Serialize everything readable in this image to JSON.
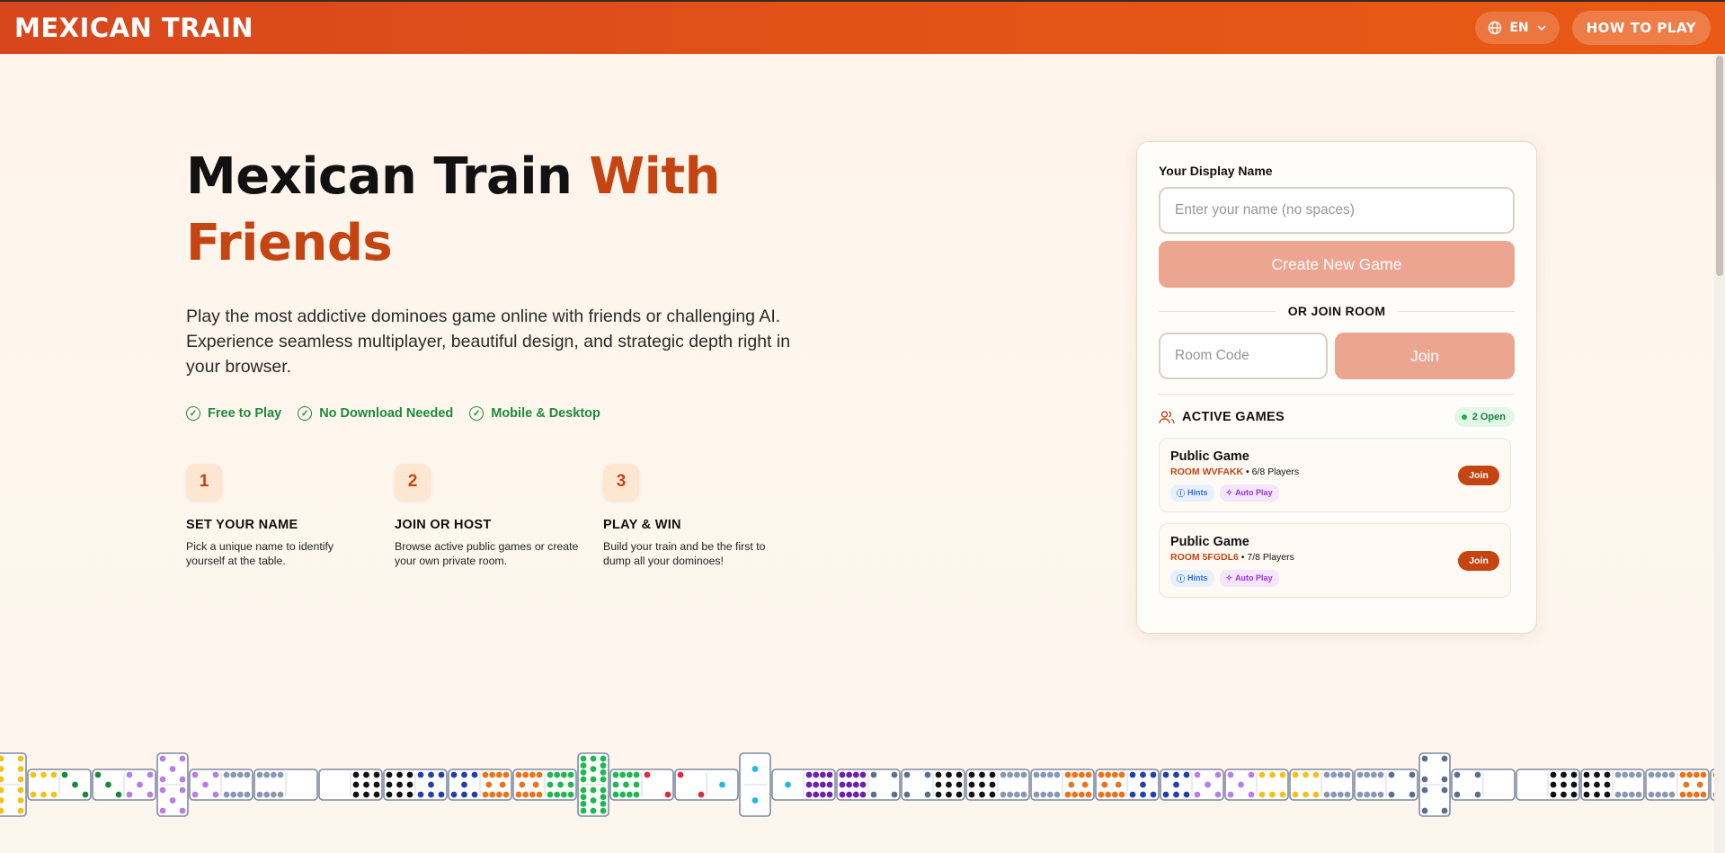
{
  "header": {
    "brand": "MEXICAN TRAIN",
    "language": "EN",
    "how_to_play": "HOW TO PLAY"
  },
  "hero": {
    "title_main": "Mexican Train ",
    "title_accent_1": "With",
    "title_accent_2": "Friends",
    "lead": "Play the most addictive dominoes game online with friends or challenging AI. Experience seamless multiplayer, beautiful design, and strategic depth right in your browser.",
    "features": [
      "Free to Play",
      "No Download Needed",
      "Mobile & Desktop"
    ]
  },
  "steps": [
    {
      "num": "1",
      "title": "SET YOUR NAME",
      "desc": "Pick a unique name to identify yourself at the table."
    },
    {
      "num": "2",
      "title": "JOIN OR HOST",
      "desc": "Browse active public games or create your own private room."
    },
    {
      "num": "3",
      "title": "PLAY & WIN",
      "desc": "Build your train and be the first to dump all your dominoes!"
    }
  ],
  "panel": {
    "name_label": "Your Display Name",
    "name_placeholder": "Enter your name (no spaces)",
    "create_button": "Create New Game",
    "or_join": "OR JOIN ROOM",
    "room_placeholder": "Room Code",
    "join_button": "Join",
    "active_games_title": "ACTIVE GAMES",
    "open_count": "2 Open",
    "games": [
      {
        "title": "Public Game",
        "room": "ROOM WVFAKK",
        "players": "• 6/8 Players",
        "hints": "Hints",
        "auto": "Auto Play",
        "join": "Join"
      },
      {
        "title": "Public Game",
        "room": "ROOM 5FGDL6",
        "players": "• 7/8 Players",
        "hints": "Hints",
        "auto": "Auto Play",
        "join": "Join"
      }
    ]
  },
  "colors": {
    "brand_orange": "#e25218",
    "accent": "#c44512",
    "feature_green": "#1c8a3a",
    "disabled_button": "#eca591"
  },
  "dominoes": [
    {
      "a": 6,
      "b": 6,
      "double": true
    },
    {
      "a": 6,
      "b": 3
    },
    {
      "a": 3,
      "b": 5
    },
    {
      "a": 5,
      "b": 5,
      "double": true
    },
    {
      "a": 5,
      "b": 8
    },
    {
      "a": 8,
      "b": 0
    },
    {
      "a": 0,
      "b": 9
    },
    {
      "a": 9,
      "b": 7
    },
    {
      "a": 7,
      "b": 10
    },
    {
      "a": 10,
      "b": 11
    },
    {
      "a": 11,
      "b": 11,
      "double": true
    },
    {
      "a": 11,
      "b": 2
    },
    {
      "a": 2,
      "b": 1
    },
    {
      "a": 1,
      "b": 1,
      "double": true
    },
    {
      "a": 1,
      "b": 12
    },
    {
      "a": 12,
      "b": 4
    },
    {
      "a": 4,
      "b": 9
    },
    {
      "a": 9,
      "b": 8
    },
    {
      "a": 8,
      "b": 10
    },
    {
      "a": 10,
      "b": 7
    },
    {
      "a": 7,
      "b": 5
    },
    {
      "a": 5,
      "b": 6
    },
    {
      "a": 6,
      "b": 8
    },
    {
      "a": 8,
      "b": 4
    },
    {
      "a": 4,
      "b": 4,
      "double": true
    },
    {
      "a": 4,
      "b": 0
    },
    {
      "a": 0,
      "b": 9
    },
    {
      "a": 9,
      "b": 8
    },
    {
      "a": 8,
      "b": 10
    },
    {
      "a": 10,
      "b": 5
    },
    {
      "a": 5,
      "b": 5
    }
  ]
}
